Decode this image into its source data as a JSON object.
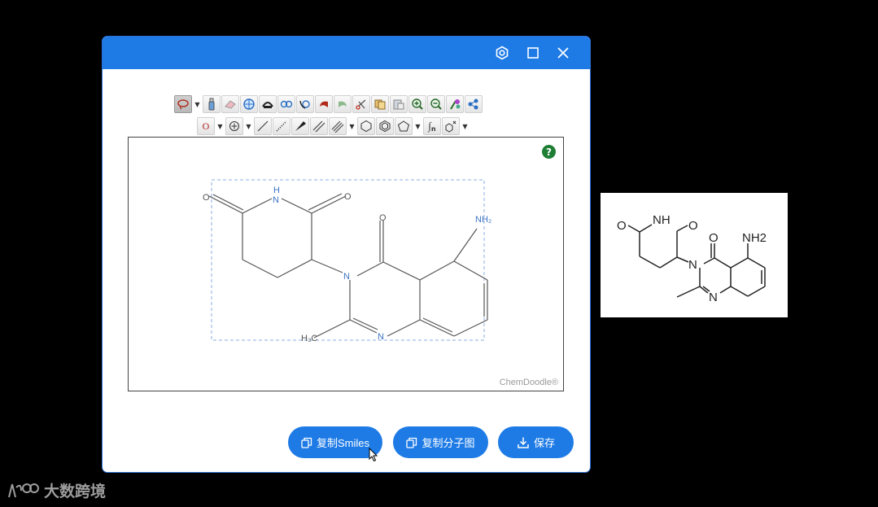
{
  "window": {
    "controls": [
      "settings-icon",
      "maximize-icon",
      "close-icon"
    ]
  },
  "toolbar": {
    "row1": [
      "lasso-icon",
      "dropdown",
      "bottle-icon",
      "eraser-icon",
      "center-icon",
      "flip-icon",
      "rotate-left-icon",
      "rotate-right-icon",
      "undo-icon",
      "redo-icon",
      "cut-icon",
      "copy-icon",
      "paste-icon",
      "zoom-in-icon",
      "zoom-out-icon",
      "clean-icon",
      "template-icon"
    ],
    "row2": [
      "atom-label",
      "dropdown",
      "charge-icon",
      "dropdown",
      "single-bond-icon",
      "dashed-bond-icon",
      "wedge-bond-icon",
      "double-bond-icon",
      "triple-bond-icon",
      "dropdown",
      "cyclohexane-icon",
      "benzene-icon",
      "cyclopentane-icon",
      "dropdown",
      "chain-icon",
      "label-icon",
      "dropdown"
    ],
    "atom_label": "O",
    "chain_label": "n"
  },
  "canvas": {
    "help": "?",
    "watermark": "ChemDoodle®",
    "atoms": {
      "O1": "O",
      "O2": "O",
      "O3": "O",
      "NH": "N",
      "H": "H",
      "N3": "N",
      "N1": "N",
      "NH2": "NH₂",
      "CH3": "H₃C"
    }
  },
  "buttons": {
    "copy_smiles": "复制Smiles",
    "copy_image": "复制分子图",
    "save": "保存"
  },
  "preview": {
    "atoms": {
      "O1": "O",
      "NH": "NH",
      "O2": "O",
      "O3": "O",
      "NH2": "NH2",
      "N3": "N",
      "N1": "N"
    }
  },
  "logo": {
    "text": "大数跨境"
  },
  "colors": {
    "titlebar": "#1e7be6",
    "button": "#1e7be6",
    "atom_n": "#3b74c4",
    "help": "#1e7e34"
  }
}
